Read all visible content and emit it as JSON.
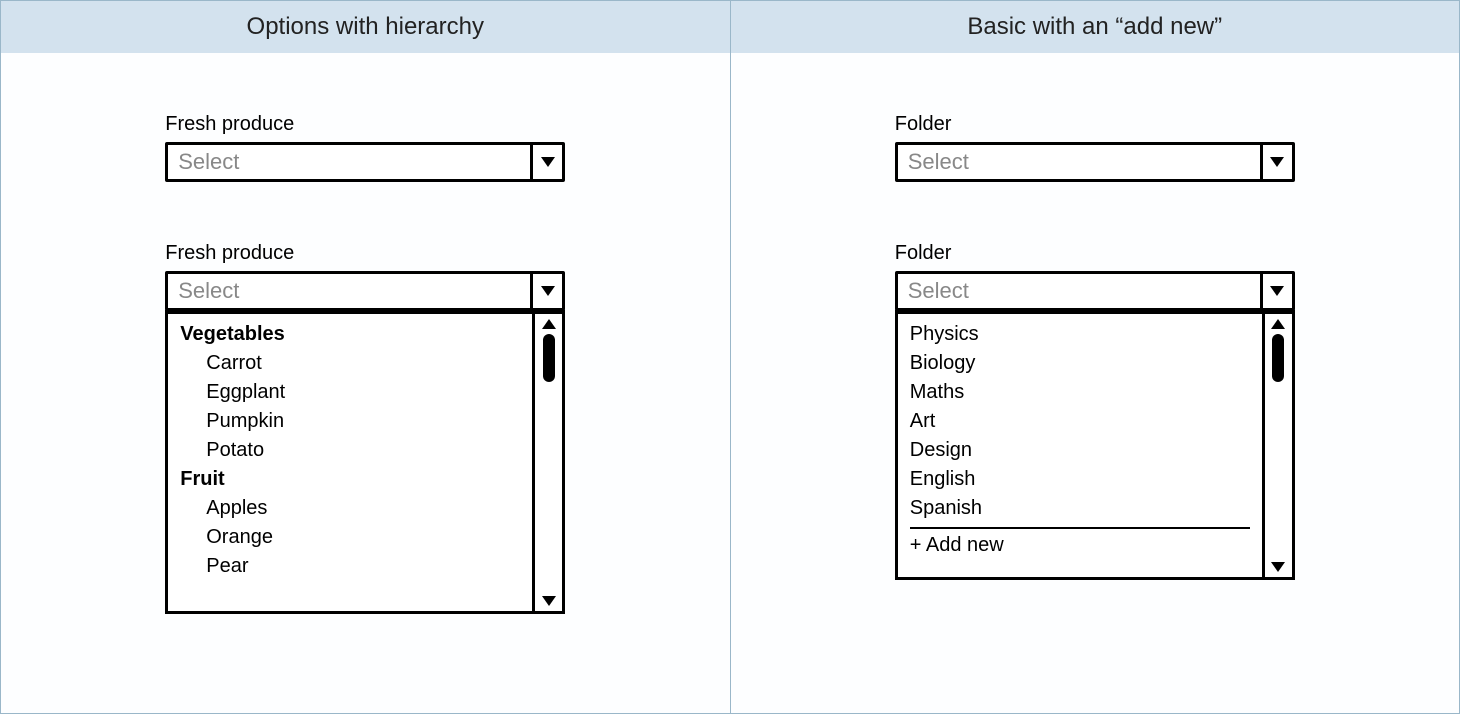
{
  "left": {
    "title": "Options with hierarchy",
    "label": "Fresh produce",
    "placeholder": "Select",
    "groups": [
      {
        "name": "Vegetables",
        "items": [
          "Carrot",
          "Eggplant",
          "Pumpkin",
          "Potato"
        ]
      },
      {
        "name": "Fruit",
        "items": [
          "Apples",
          "Orange",
          "Pear"
        ]
      }
    ]
  },
  "right": {
    "title": "Basic with an “add new”",
    "label": "Folder",
    "placeholder": "Select",
    "items": [
      "Physics",
      "Biology",
      "Maths",
      "Art",
      "Design",
      "English",
      "Spanish"
    ],
    "add_new": "+ Add new"
  }
}
